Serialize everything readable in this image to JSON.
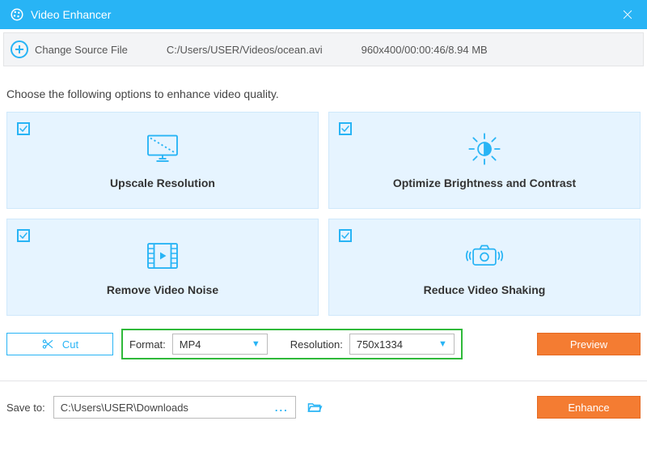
{
  "colors": {
    "accent": "#28b4f5",
    "orange": "#f47c32",
    "green": "#2fb93a"
  },
  "titlebar": {
    "title": "Video Enhancer",
    "logo_icon": "palette-icon",
    "close_icon": "close-icon"
  },
  "sourcebar": {
    "change_label": "Change Source File",
    "source_path": "C:/Users/USER/Videos/ocean.avi",
    "meta": "960x400/00:00:46/8.94 MB"
  },
  "instructions": "Choose the following options to enhance video quality.",
  "cards": [
    {
      "id": "upscale",
      "label": "Upscale Resolution",
      "icon": "monitor-icon",
      "checked": true
    },
    {
      "id": "brightness",
      "label": "Optimize Brightness and Contrast",
      "icon": "sun-icon",
      "checked": true
    },
    {
      "id": "noise",
      "label": "Remove Video Noise",
      "icon": "filmstrip-icon",
      "checked": true
    },
    {
      "id": "shaking",
      "label": "Reduce Video Shaking",
      "icon": "camera-icon",
      "checked": true
    }
  ],
  "cut_label": "Cut",
  "format": {
    "label": "Format:",
    "value": "MP4"
  },
  "resolution": {
    "label": "Resolution:",
    "value": "750x1334"
  },
  "preview_label": "Preview",
  "save": {
    "label": "Save to:",
    "path": "C:\\Users\\USER\\Downloads",
    "browse_label": "...",
    "open_icon": "folder-open-icon"
  },
  "enhance_label": "Enhance"
}
